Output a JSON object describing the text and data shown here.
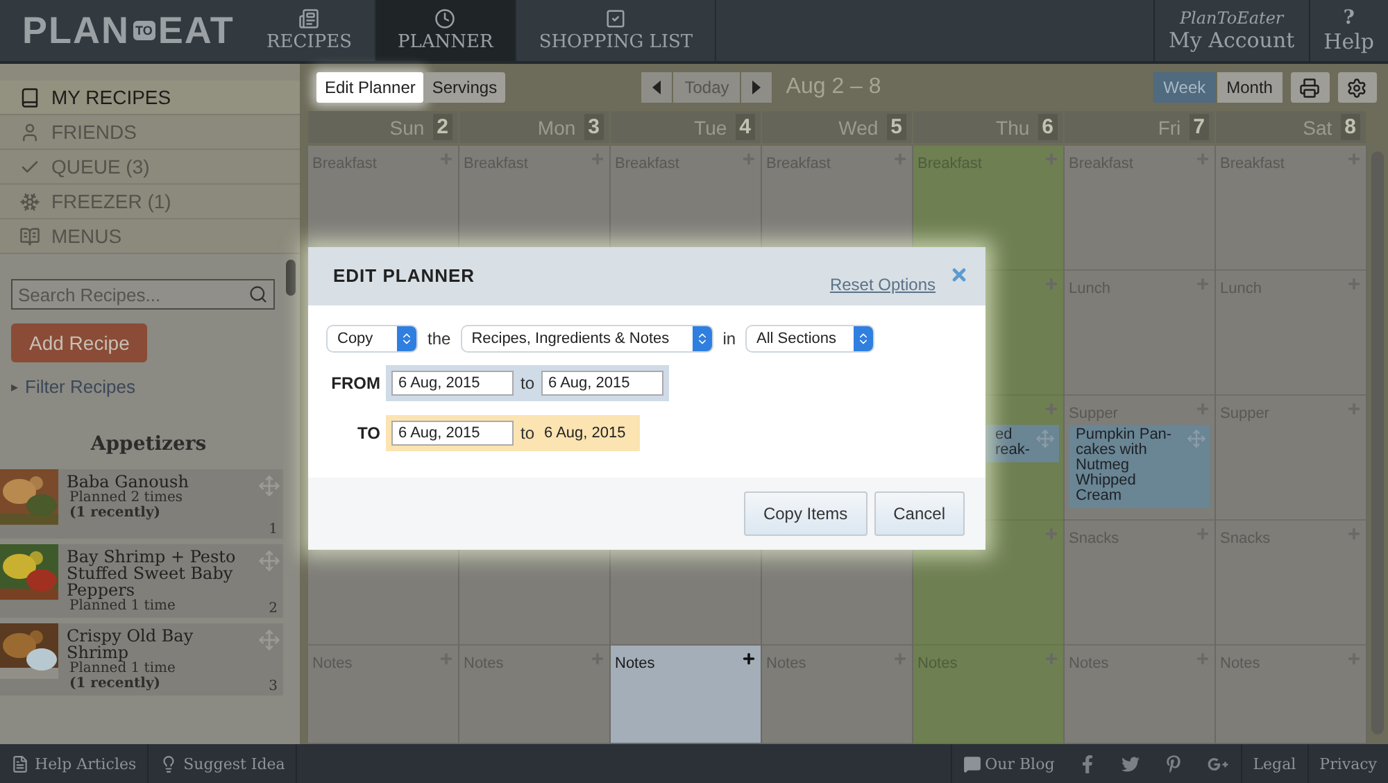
{
  "header": {
    "logo": {
      "left": "PLAN",
      "middle": "TO",
      "right": "EAT"
    },
    "nav": [
      {
        "label": "RECIPES",
        "kind": "recipes",
        "selected": false
      },
      {
        "label": "PLANNER",
        "kind": "planner",
        "selected": true
      },
      {
        "label": "SHOPPING LIST",
        "kind": "list",
        "selected": false
      }
    ],
    "account": {
      "user": "PlanToEater",
      "label": "My Account"
    },
    "help": {
      "mark": "?",
      "label": "Help"
    }
  },
  "sidebar": {
    "menu": [
      {
        "label": "MY RECIPES",
        "kind": "book",
        "selected": true
      },
      {
        "label": "FRIENDS",
        "kind": "person",
        "selected": false
      },
      {
        "label": "QUEUE (3)",
        "kind": "check",
        "selected": false
      },
      {
        "label": "FREEZER (1)",
        "kind": "snow",
        "selected": false
      },
      {
        "label": "MENUS",
        "kind": "menu",
        "selected": false
      }
    ],
    "search": {
      "placeholder": "Search Recipes..."
    },
    "add_button": "Add Recipe",
    "filter": {
      "marker": "▸",
      "label": "Filter Recipes"
    },
    "category": "Appetizers",
    "recipes": [
      {
        "name": "Baba Ganoush",
        "planned": "Planned 2 times",
        "recent": "(1 recently)",
        "number": "1"
      },
      {
        "name": "Bay Shrimp + Pesto Stuffed Sweet Baby Peppers",
        "planned": "Planned 1 time",
        "number": "2"
      },
      {
        "name": "Crispy Old Bay Shrimp",
        "planned": "Planned 1 time",
        "recent": "(1 recently)",
        "number": "3"
      }
    ]
  },
  "toolbar": {
    "modes": [
      {
        "label": "Edit Planner",
        "selected": true
      },
      {
        "label": "Servings",
        "selected": false
      }
    ],
    "today": {
      "label": "Today",
      "disabled": true
    },
    "range": "Aug 2 – 8",
    "views": [
      {
        "label": "Week",
        "selected": true
      },
      {
        "label": "Month",
        "selected": false
      }
    ]
  },
  "days": [
    {
      "name": "Sun",
      "number": "2",
      "today": false,
      "cells": [
        {
          "kind": "breakfast",
          "label": "Breakfast",
          "active": false
        },
        {
          "kind": "notes",
          "label": "Notes",
          "active": false
        }
      ]
    },
    {
      "name": "Mon",
      "number": "3",
      "today": false,
      "cells": [
        {
          "kind": "breakfast",
          "label": "Breakfast",
          "active": false
        },
        {
          "kind": "notes",
          "label": "Notes",
          "active": false
        }
      ]
    },
    {
      "name": "Tue",
      "number": "4",
      "today": false,
      "cells": [
        {
          "kind": "breakfast",
          "label": "Breakfast",
          "active": false
        },
        {
          "kind": "notes",
          "label": "Notes",
          "active": true
        }
      ]
    },
    {
      "name": "Wed",
      "number": "5",
      "today": false,
      "cells": [
        {
          "kind": "breakfast",
          "label": "Breakfast",
          "active": false
        },
        {
          "kind": "notes",
          "label": "Notes",
          "active": false
        }
      ]
    },
    {
      "name": "Thu",
      "number": "6",
      "today": true,
      "cells": [
        {
          "kind": "breakfast",
          "label": "Breakfast",
          "active": false
        },
        {
          "kind": "lunch",
          "active": false
        },
        {
          "kind": "supper",
          "active": false,
          "recipe": {
            "lines": [
              "ed",
              "reak-"
            ]
          }
        },
        {
          "kind": "snacks",
          "active": false
        },
        {
          "kind": "notes",
          "label": "Notes",
          "active": false
        }
      ]
    },
    {
      "name": "Fri",
      "number": "7",
      "today": false,
      "cells": [
        {
          "kind": "breakfast",
          "label": "Breakfast",
          "active": false
        },
        {
          "kind": "lunch",
          "label": "Lunch",
          "active": false
        },
        {
          "kind": "supper",
          "label": "Supper",
          "active": false,
          "recipe": {
            "lines": [
              "Pumpkin Pan-",
              "cakes with",
              "Nutmeg",
              "Whipped",
              "Cream"
            ]
          }
        },
        {
          "kind": "snacks",
          "label": "Snacks",
          "active": false
        },
        {
          "kind": "notes",
          "label": "Notes",
          "active": false
        }
      ]
    },
    {
      "name": "Sat",
      "number": "8",
      "today": false,
      "cells": [
        {
          "kind": "breakfast",
          "label": "Breakfast",
          "active": false
        },
        {
          "kind": "lunch",
          "label": "Lunch",
          "active": false
        },
        {
          "kind": "supper",
          "label": "Supper",
          "active": false
        },
        {
          "kind": "snacks",
          "label": "Snacks",
          "active": false
        },
        {
          "kind": "notes",
          "label": "Notes",
          "active": false
        }
      ]
    }
  ],
  "modal": {
    "title": "EDIT PLANNER",
    "reset": "Reset Options",
    "action": "Copy",
    "the": "the",
    "content": "Recipes, Ingredients & Notes",
    "in": "in",
    "sections": "All Sections",
    "ranges": [
      {
        "label": "FROM",
        "kind": "source",
        "start": "6 Aug, 2015",
        "to": "to",
        "end": "6 Aug, 2015",
        "end_editable": true
      },
      {
        "label": "TO",
        "kind": "target",
        "start": "6 Aug, 2015",
        "to": "to",
        "end": "6 Aug, 2015",
        "end_editable": false
      }
    ],
    "buttons": [
      "Copy Items",
      "Cancel"
    ]
  },
  "footer": {
    "left": [
      {
        "label": "Help Articles",
        "kind": "doc"
      },
      {
        "label": "Suggest Idea",
        "kind": "bulb"
      }
    ],
    "blog": "Our Blog",
    "links": [
      "Legal",
      "Privacy"
    ]
  }
}
